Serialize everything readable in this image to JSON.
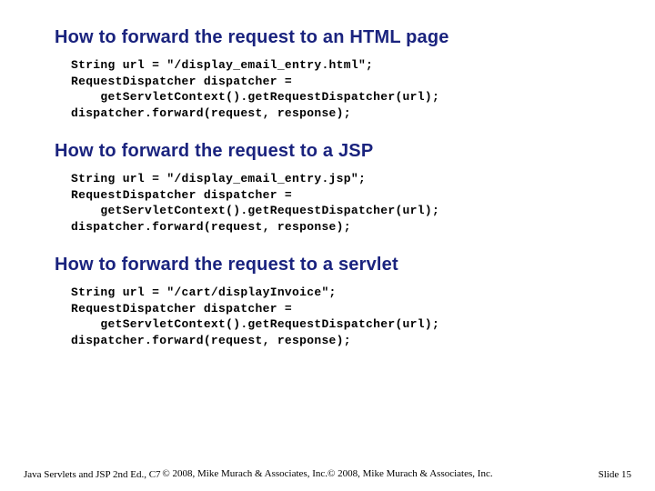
{
  "sections": [
    {
      "heading": "How to forward the request to an HTML page",
      "code": "String url = \"/display_email_entry.html\";\nRequestDispatcher dispatcher =\n    getServletContext().getRequestDispatcher(url);\ndispatcher.forward(request, response);"
    },
    {
      "heading": "How to forward the request to a JSP",
      "code": "String url = \"/display_email_entry.jsp\";\nRequestDispatcher dispatcher =\n    getServletContext().getRequestDispatcher(url);\ndispatcher.forward(request, response);"
    },
    {
      "heading": "How to forward the request to a servlet",
      "code": "String url = \"/cart/displayInvoice\";\nRequestDispatcher dispatcher =\n    getServletContext().getRequestDispatcher(url);\ndispatcher.forward(request, response);"
    }
  ],
  "footer": {
    "left": "Java Servlets and JSP 2nd Ed., C7",
    "center": "© 2008, Mike Murach & Associates, Inc.© 2008, Mike\nMurach & Associates, Inc.",
    "right": "Slide 15"
  }
}
